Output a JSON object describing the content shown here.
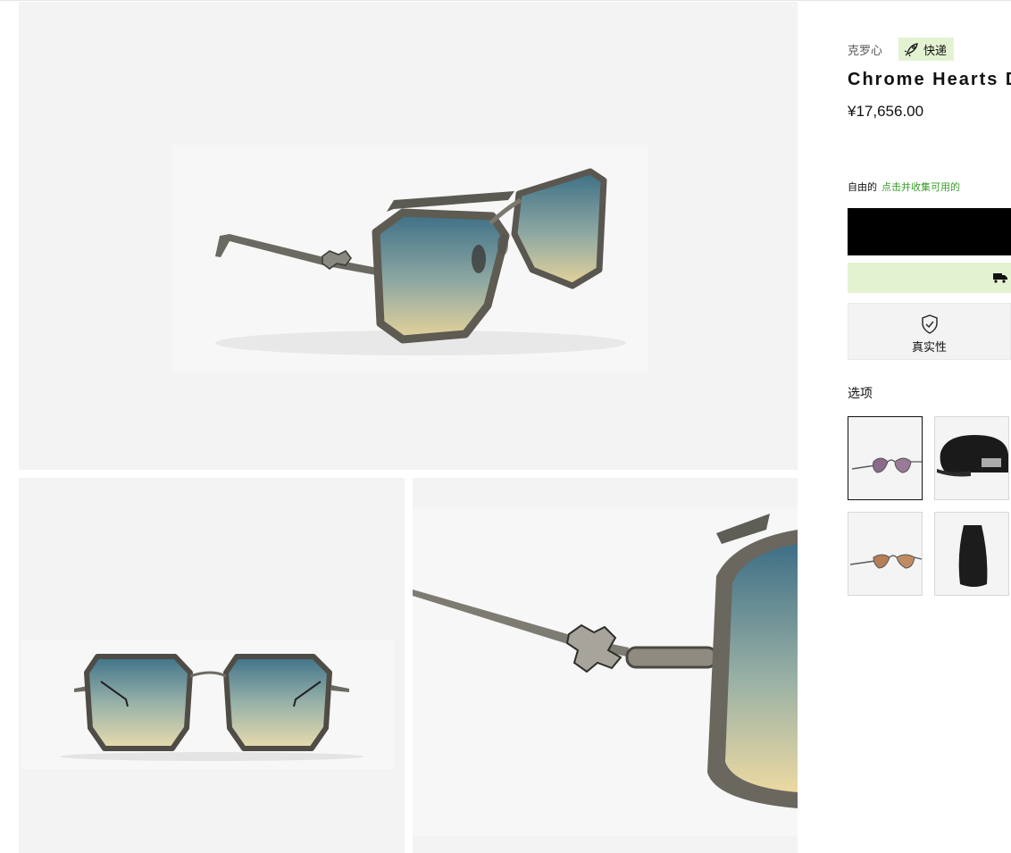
{
  "product": {
    "brand": "克罗心",
    "express_label": "快递",
    "title": "Chrome Hearts D",
    "price": "¥17,656.00"
  },
  "promo": {
    "text": "自由的",
    "link": "点击并收集可用的"
  },
  "authenticity": {
    "label": "真实性"
  },
  "options": {
    "label": "选项",
    "selected_index": 0
  },
  "colors": {
    "accent_green": "#3a9c2a",
    "badge_bg": "#e3f3d2",
    "buy_button_bg": "#000000"
  },
  "icons": {
    "express": "rocket-icon",
    "shipping": "delivery-truck-icon",
    "authenticity": "shield-check-icon"
  }
}
